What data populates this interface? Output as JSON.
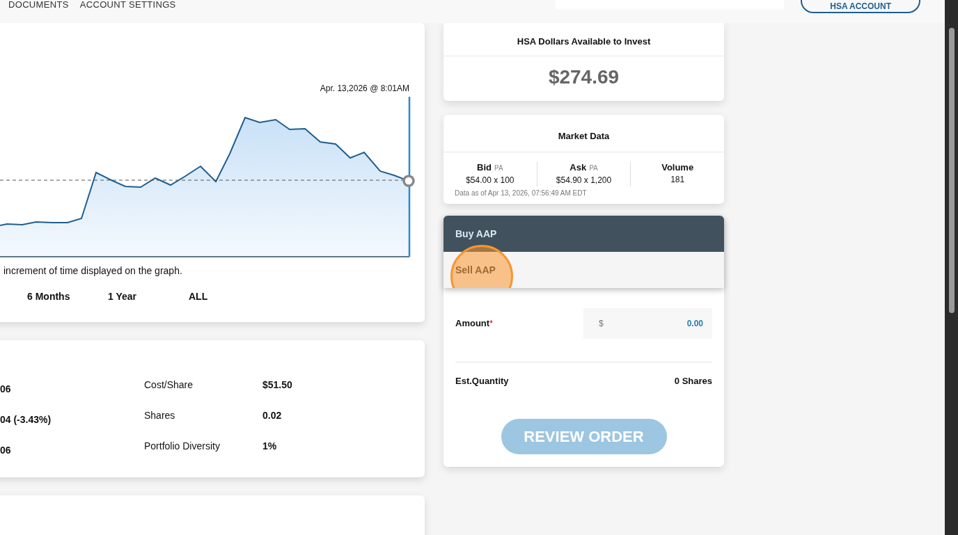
{
  "nav": {
    "links": [
      "DOCUMENTS",
      "ACCOUNT SETTINGS"
    ],
    "account_button": "HSA ACCOUNT"
  },
  "chart_card": {
    "timestamp": "Apr. 13,2026 @ 8:01AM",
    "hint": "increment of time displayed on the graph.",
    "ranges": [
      {
        "label": "6 Months",
        "selected": false
      },
      {
        "label": "1 Year",
        "selected": false
      },
      {
        "label": "ALL",
        "selected": false
      }
    ]
  },
  "position": {
    "left_values": [
      "06",
      "04 (-3.43%)",
      "06"
    ],
    "stats": [
      {
        "label": "Cost/Share",
        "value": "$51.50"
      },
      {
        "label": "Shares",
        "value": "0.02"
      },
      {
        "label": "Portfolio Diversity",
        "value": "1%"
      }
    ]
  },
  "available": {
    "title": "HSA Dollars Available to Invest",
    "amount": "$274.69"
  },
  "market": {
    "title": "Market Data",
    "columns": [
      {
        "label": "Bid",
        "tag": "PA",
        "value": "$54.00 x 100"
      },
      {
        "label": "Ask",
        "tag": "PA",
        "value": "$54.90 x 1,200"
      },
      {
        "label": "Volume",
        "value": "181"
      }
    ],
    "note": "Data as of Apr 13, 2026, 07:56:49 AM EDT"
  },
  "order": {
    "menu": [
      {
        "label": "Buy AAP",
        "selected": true
      },
      {
        "label": "Sell AAP",
        "selected": false,
        "highlighted": true
      }
    ],
    "amount_label": "Amount",
    "required_mark": "*",
    "currency": "$",
    "amount_value": "0.00",
    "quantity_label": "Est.Quantity",
    "quantity_value": "0 Shares",
    "button": "REVIEW ORDER",
    "button_disabled": true
  }
}
